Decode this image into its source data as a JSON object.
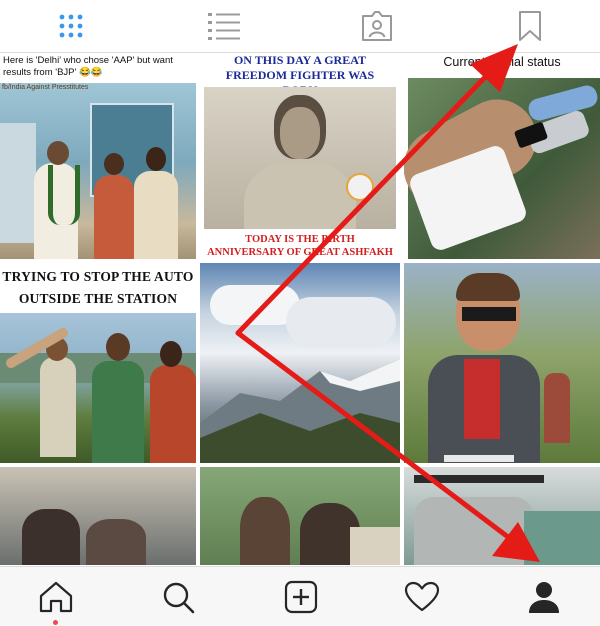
{
  "top_tabs": [
    {
      "name": "grid-view",
      "icon": "grid-icon",
      "active": true
    },
    {
      "name": "list-view",
      "icon": "list-icon",
      "active": false
    },
    {
      "name": "tagged-view",
      "icon": "tagged-photo-icon",
      "active": false
    },
    {
      "name": "saved-view",
      "icon": "bookmark-icon",
      "active": false
    }
  ],
  "posts": {
    "p1": {
      "caption": "Here is 'Delhi' who chose 'AAP' but want results from 'BJP' 😂😂",
      "source": "fb/India Against Presstitutes"
    },
    "p2": {
      "header": "ON THIS DAY A GREAT FREEDOM FIGHTER WAS BORN",
      "footer": "TODAY IS THE BIRTH ANNIVERSARY OF GREAT ASHFAKH ULLAH KHAN !!"
    },
    "p3": {
      "caption": "Current official status"
    },
    "p4": {
      "caption": "TRYING TO STOP THE AUTO OUTSIDE THE STATION LIKE"
    },
    "p5": {},
    "p6": {},
    "p7": {},
    "p8": {},
    "p9": {}
  },
  "bottom_nav": [
    {
      "name": "home",
      "icon": "home-icon",
      "active": true
    },
    {
      "name": "search",
      "icon": "search-icon",
      "active": false
    },
    {
      "name": "new-post",
      "icon": "plus-square-icon",
      "active": false
    },
    {
      "name": "activity",
      "icon": "heart-icon",
      "active": false
    },
    {
      "name": "profile",
      "icon": "profile-icon",
      "active": false
    }
  ],
  "colors": {
    "accent_blue": "#3897f0",
    "annotation_red": "#e41b17",
    "notification_dot": "#ed4956",
    "icon_gray": "#999999",
    "icon_dark": "#262626"
  }
}
